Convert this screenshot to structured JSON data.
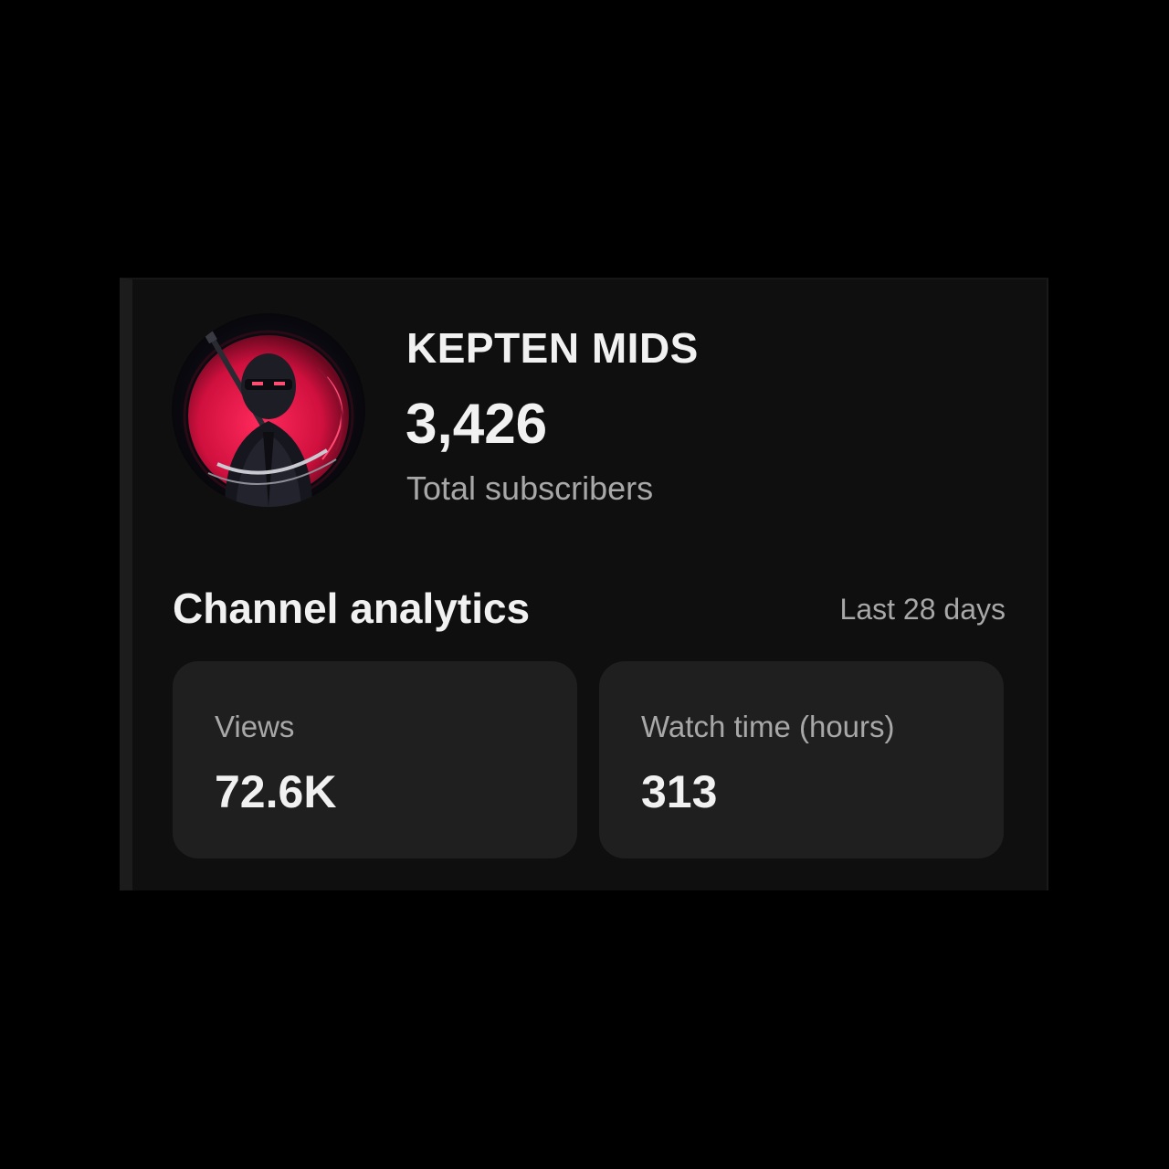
{
  "channel": {
    "name": "KEPTEN MIDS",
    "subscriber_count": "3,426",
    "subscriber_label": "Total subscribers",
    "avatar_icon": "ninja-avatar-icon"
  },
  "analytics": {
    "title": "Channel analytics",
    "period": "Last 28 days",
    "metrics": [
      {
        "label": "Views",
        "value": "72.6K"
      },
      {
        "label": "Watch time (hours)",
        "value": "313"
      }
    ]
  },
  "colors": {
    "page_background": "#000000",
    "card_background": "#0f0f0f",
    "tile_background": "#1f1f1f",
    "primary_text": "#f1f1f1",
    "secondary_text": "#a8a8a8",
    "avatar_accent": "#e0194a"
  }
}
